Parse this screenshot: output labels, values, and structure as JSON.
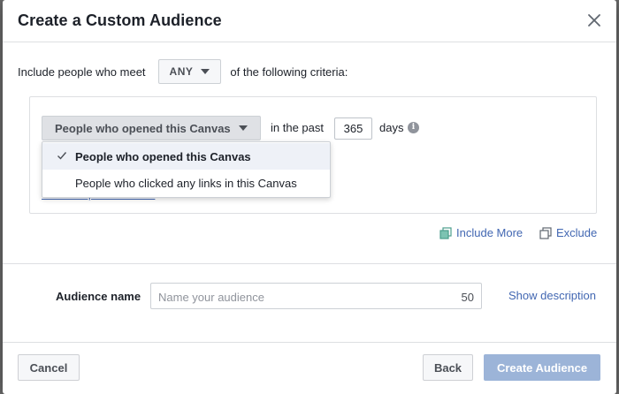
{
  "modal": {
    "title": "Create a Custom Audience"
  },
  "criteria": {
    "prefix": "Include people who meet",
    "match_value": "ANY",
    "suffix": "of the following criteria:"
  },
  "rule": {
    "selected_option": "People who opened this Canvas",
    "in_past_label": "in the past",
    "days_value": "365",
    "days_label": "days",
    "select_specific_link": "+ Select specific canvas"
  },
  "dropdown": {
    "items": [
      {
        "label": "People who opened this Canvas",
        "selected": true
      },
      {
        "label": "People who clicked any links in this Canvas",
        "selected": false
      }
    ]
  },
  "actions": {
    "include_more": "Include More",
    "exclude": "Exclude"
  },
  "audience": {
    "label": "Audience name",
    "placeholder": "Name your audience",
    "char_count": "50",
    "show_description": "Show description"
  },
  "footer": {
    "cancel": "Cancel",
    "back": "Back",
    "create": "Create Audience"
  },
  "colors": {
    "link": "#4267b2",
    "primary_disabled": "#9cb4d8",
    "border": "#dddfe2"
  }
}
